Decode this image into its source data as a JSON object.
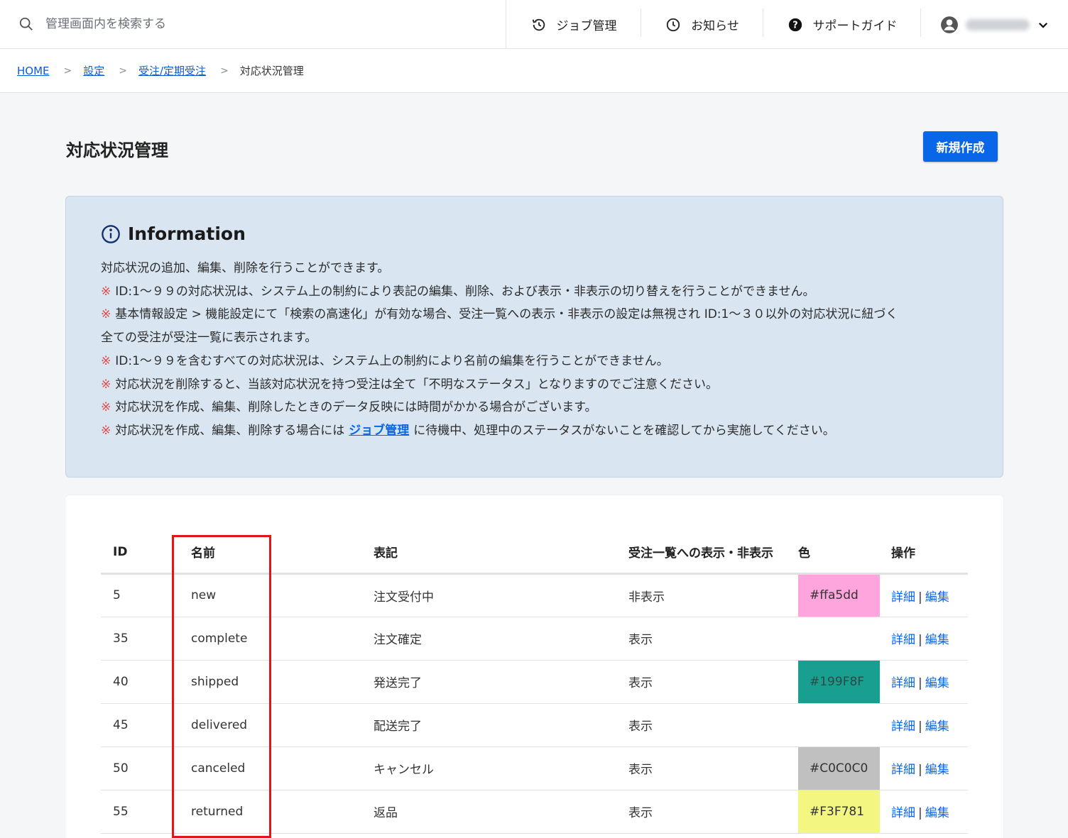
{
  "header": {
    "search_placeholder": "管理画面内を検索する",
    "nav": {
      "job": "ジョブ管理",
      "news": "お知らせ",
      "guide": "サポートガイド"
    }
  },
  "breadcrumb": {
    "home": "HOME",
    "settings": "設定",
    "orders": "受注/定期受注",
    "current": "対応状況管理",
    "separator": ">"
  },
  "page": {
    "title": "対応状況管理",
    "new_button": "新規作成"
  },
  "info": {
    "title": "Information",
    "intro": "対応状況の追加、編集、削除を行うことができます。",
    "mark": "※",
    "notes": [
      "ID:1～９９の対応状況は、システム上の制約により表記の編集、削除、および表示・非表示の切り替えを行うことができません。",
      "基本情報設定 > 機能設定にて「検索の高速化」が有効な場合、受注一覧への表示・非表示の設定は無視され ID:1～３０以外の対応状況に紐づく",
      "ID:1～９９を含むすべての対応状況は、システム上の制約により名前の編集を行うことができません。",
      "対応状況を削除すると、当該対応状況を持つ受注は全て「不明なステータス」となりますのでご注意ください。",
      "対応状況を作成、編集、削除したときのデータ反映には時間がかかる場合がございます。"
    ],
    "note2_cont": "全ての受注が受注一覧に表示されます。",
    "last_note_pre": "対応状況を作成、編集、削除する場合には",
    "last_note_link": "ジョブ管理",
    "last_note_post": "に待機中、処理中のステータスがないことを確認してから実施してください。"
  },
  "table": {
    "headers": {
      "id": "ID",
      "name": "名前",
      "label": "表記",
      "visibility": "受注一覧への表示・非表示",
      "color": "色",
      "ops": "操作"
    },
    "ops": {
      "detail": "詳細",
      "edit": "編集",
      "pipe": "|"
    },
    "rows": [
      {
        "id": "5",
        "name": "new",
        "label": "注文受付中",
        "visibility": "非表示",
        "color": "#ffa5dd",
        "color_bg": "#ffa5dd",
        "color_fg": "#333333"
      },
      {
        "id": "35",
        "name": "complete",
        "label": "注文確定",
        "visibility": "表示",
        "color": "",
        "color_bg": "",
        "color_fg": "#333333"
      },
      {
        "id": "40",
        "name": "shipped",
        "label": "発送完了",
        "visibility": "表示",
        "color": "#199F8F",
        "color_bg": "#199F8F",
        "color_fg": "#2b4a46"
      },
      {
        "id": "45",
        "name": "delivered",
        "label": "配送完了",
        "visibility": "表示",
        "color": "",
        "color_bg": "",
        "color_fg": "#333333"
      },
      {
        "id": "50",
        "name": "canceled",
        "label": "キャンセル",
        "visibility": "表示",
        "color": "#C0C0C0",
        "color_bg": "#C0C0C0",
        "color_fg": "#333333"
      },
      {
        "id": "55",
        "name": "returned",
        "label": "返品",
        "visibility": "表示",
        "color": "#F3F781",
        "color_bg": "#F3F781",
        "color_fg": "#333333"
      }
    ]
  },
  "colors": {
    "accent": "#0a66e8",
    "highlight": "#e5141a",
    "info_bg": "#d9e6f2",
    "note_mark": "#e04848"
  },
  "icons": {
    "search": "search-icon",
    "job": "history-icon",
    "news": "clock-icon",
    "guide": "help-icon",
    "user": "user-avatar-icon",
    "dropdown": "chevron-down-icon",
    "info": "info-icon"
  }
}
